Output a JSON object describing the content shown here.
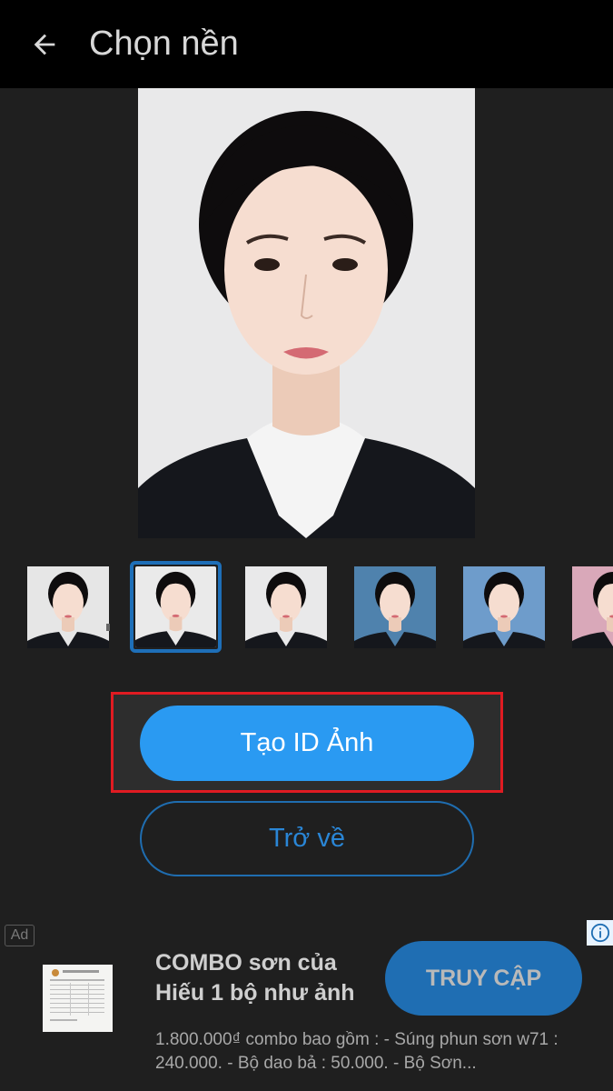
{
  "header": {
    "title": "Chọn nền",
    "back_icon": "arrow-left-icon"
  },
  "preview": {
    "background_color": "#e9e9ea"
  },
  "thumbnails": [
    {
      "bg": "#e6e6e6",
      "selected": false
    },
    {
      "bg": "#eaeaea",
      "selected": true
    },
    {
      "bg": "#e9e9ea",
      "selected": false
    },
    {
      "bg": "#4f82ad",
      "selected": false
    },
    {
      "bg": "#6e9ccb",
      "selected": false
    },
    {
      "bg": "#d9a8b9",
      "selected": false
    }
  ],
  "actions": {
    "create_label": "Tạo ID Ảnh",
    "back_label": "Trở về"
  },
  "ad": {
    "badge": "Ad",
    "info_icon": "info-icon",
    "title": "COMBO sơn của Hiếu 1 bộ như ảnh",
    "cta_label": "TRUY CẬP",
    "description": "1.800.000₫ combo bao gồm : - Súng phun sơn w71 : 240.000. - Bộ dao bả : 50.000. - Bộ Sơn..."
  },
  "colors": {
    "accent": "#2a9af2",
    "selected_border": "#1e6fb8",
    "highlight": "#e01b22"
  }
}
